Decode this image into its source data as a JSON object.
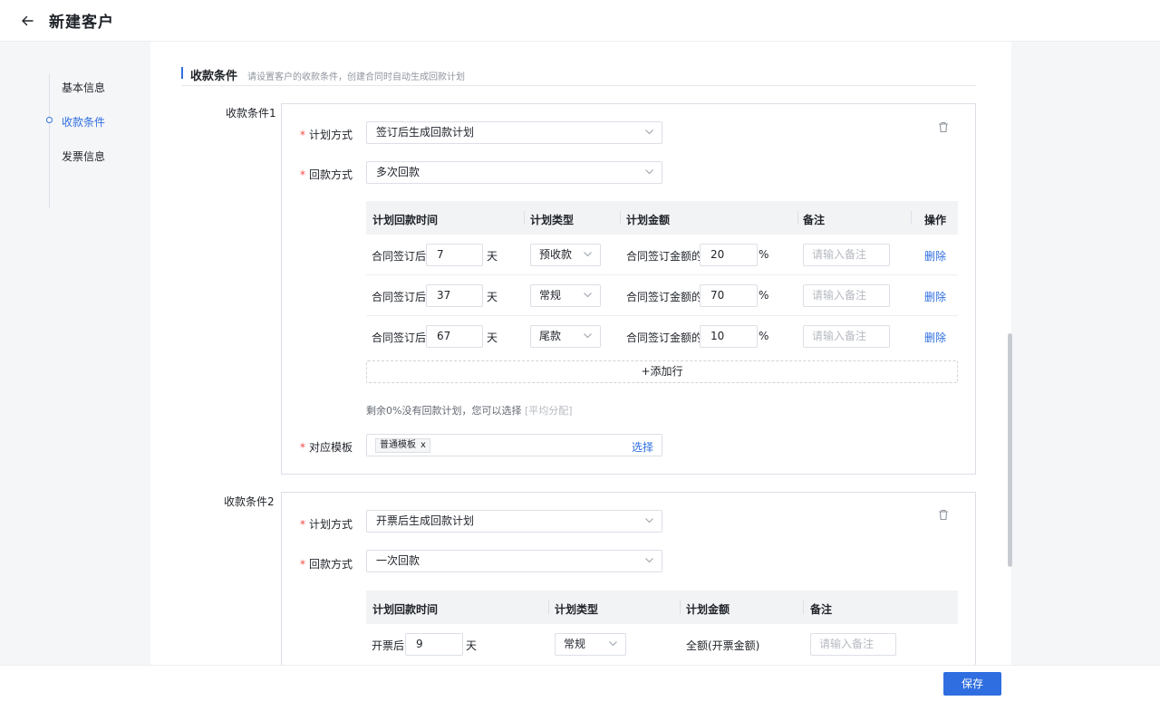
{
  "header": {
    "title": "新建客户"
  },
  "nav": {
    "steps": [
      {
        "label": "基本信息"
      },
      {
        "label": "收款条件"
      },
      {
        "label": "发票信息"
      }
    ]
  },
  "section": {
    "title": "收款条件",
    "description": "请设置客户的收款条件，创建合同时自动生成回款计划"
  },
  "cond1": {
    "label": "收款条件1",
    "plan_method_label": "计划方式",
    "plan_method_value": "签订后生成回款计划",
    "payment_method_label": "回款方式",
    "payment_method_value": "多次回款",
    "table_headers": [
      "计划回款时间",
      "计划类型",
      "计划金额",
      "备注",
      "操作"
    ],
    "rows": [
      {
        "prefix": "合同签订后",
        "days": "7",
        "unit": "天",
        "type": "预收款",
        "amount_prefix": "合同签订金额的",
        "percent": "20",
        "percent_unit": "%",
        "note_placeholder": "请输入备注",
        "action": "删除"
      },
      {
        "prefix": "合同签订后",
        "days": "37",
        "unit": "天",
        "type": "常规",
        "amount_prefix": "合同签订金额的",
        "percent": "70",
        "percent_unit": "%",
        "note_placeholder": "请输入备注",
        "action": "删除"
      },
      {
        "prefix": "合同签订后",
        "days": "67",
        "unit": "天",
        "type": "尾款",
        "amount_prefix": "合同签订金额的",
        "percent": "10",
        "percent_unit": "%",
        "note_placeholder": "请输入备注",
        "action": "删除"
      }
    ],
    "add_row": "+添加行",
    "hint": "剩余0%没有回款计划，您可以选择",
    "hint_link": "[平均分配]",
    "template_label": "对应模板",
    "template_tag": "普通模板",
    "template_tag_close": "x",
    "template_select": "选择"
  },
  "cond2": {
    "label": "收款条件2",
    "plan_method_label": "计划方式",
    "plan_method_value": "开票后生成回款计划",
    "payment_method_label": "回款方式",
    "payment_method_value": "一次回款",
    "table_headers": [
      "计划回款时间",
      "计划类型",
      "计划金额",
      "备注"
    ],
    "rows": [
      {
        "prefix": "开票后",
        "days": "9",
        "unit": "天",
        "type": "常规",
        "amount": "全额(开票金额)",
        "note_placeholder": "请输入备注"
      }
    ]
  },
  "footer": {
    "save_label": "保存"
  },
  "colors": {
    "accent": "#2f6ee0",
    "required": "#f54a45"
  },
  "icons": [
    "back-arrow-icon",
    "trash-icon",
    "chevron-down-icon"
  ]
}
